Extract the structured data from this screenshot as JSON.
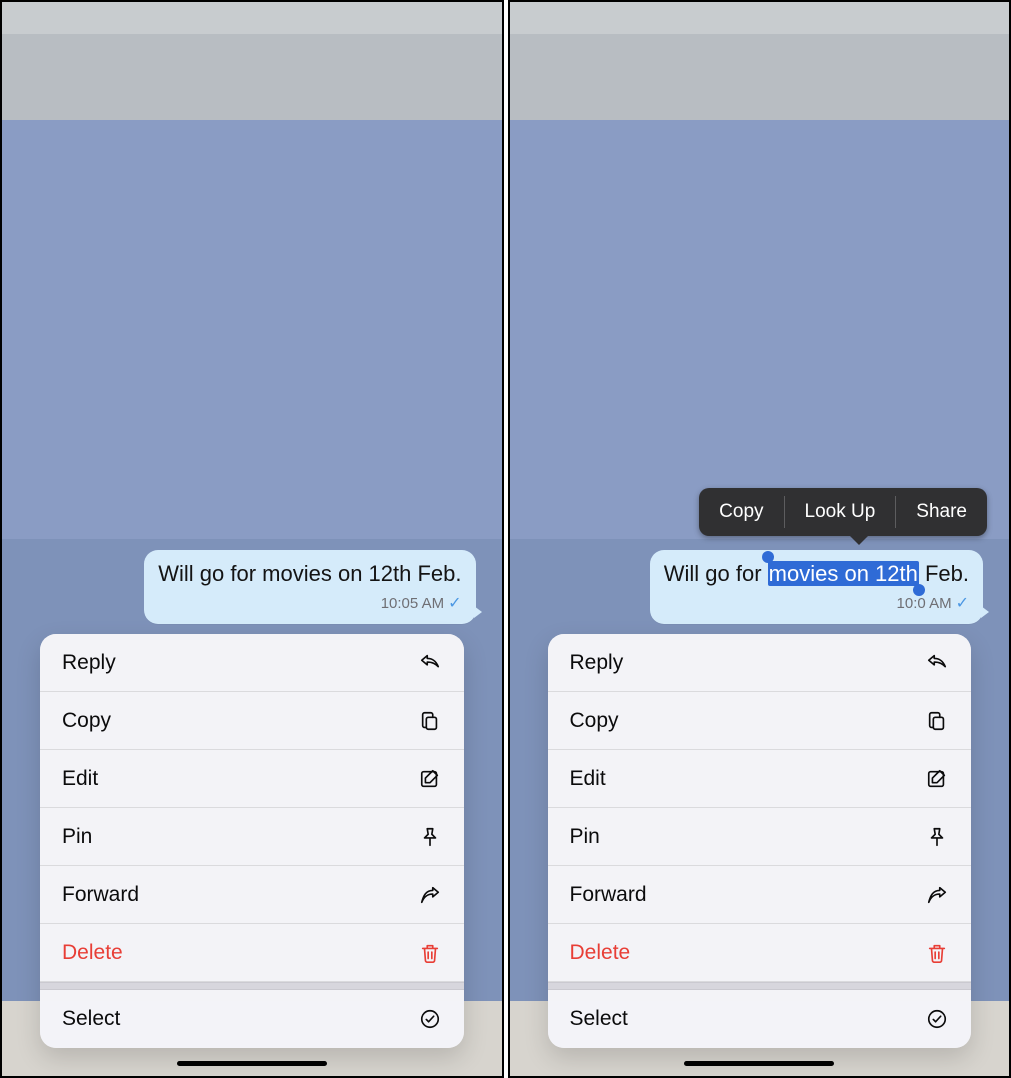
{
  "left": {
    "message": {
      "text_before": "Will go for movies on 12th Feb.",
      "time": "10:05 AM"
    },
    "menu": {
      "reply": "Reply",
      "copy": "Copy",
      "edit": "Edit",
      "pin": "Pin",
      "forward": "Forward",
      "delete": "Delete",
      "select": "Select"
    }
  },
  "right": {
    "message": {
      "before_sel": "Will go for ",
      "selected": "movies on 12th",
      "after_sel": " Feb.",
      "time_visible": "10:0   AM"
    },
    "popup": {
      "copy": "Copy",
      "lookup": "Look Up",
      "share": "Share"
    },
    "menu": {
      "reply": "Reply",
      "copy": "Copy",
      "edit": "Edit",
      "pin": "Pin",
      "forward": "Forward",
      "delete": "Delete",
      "select": "Select"
    }
  }
}
